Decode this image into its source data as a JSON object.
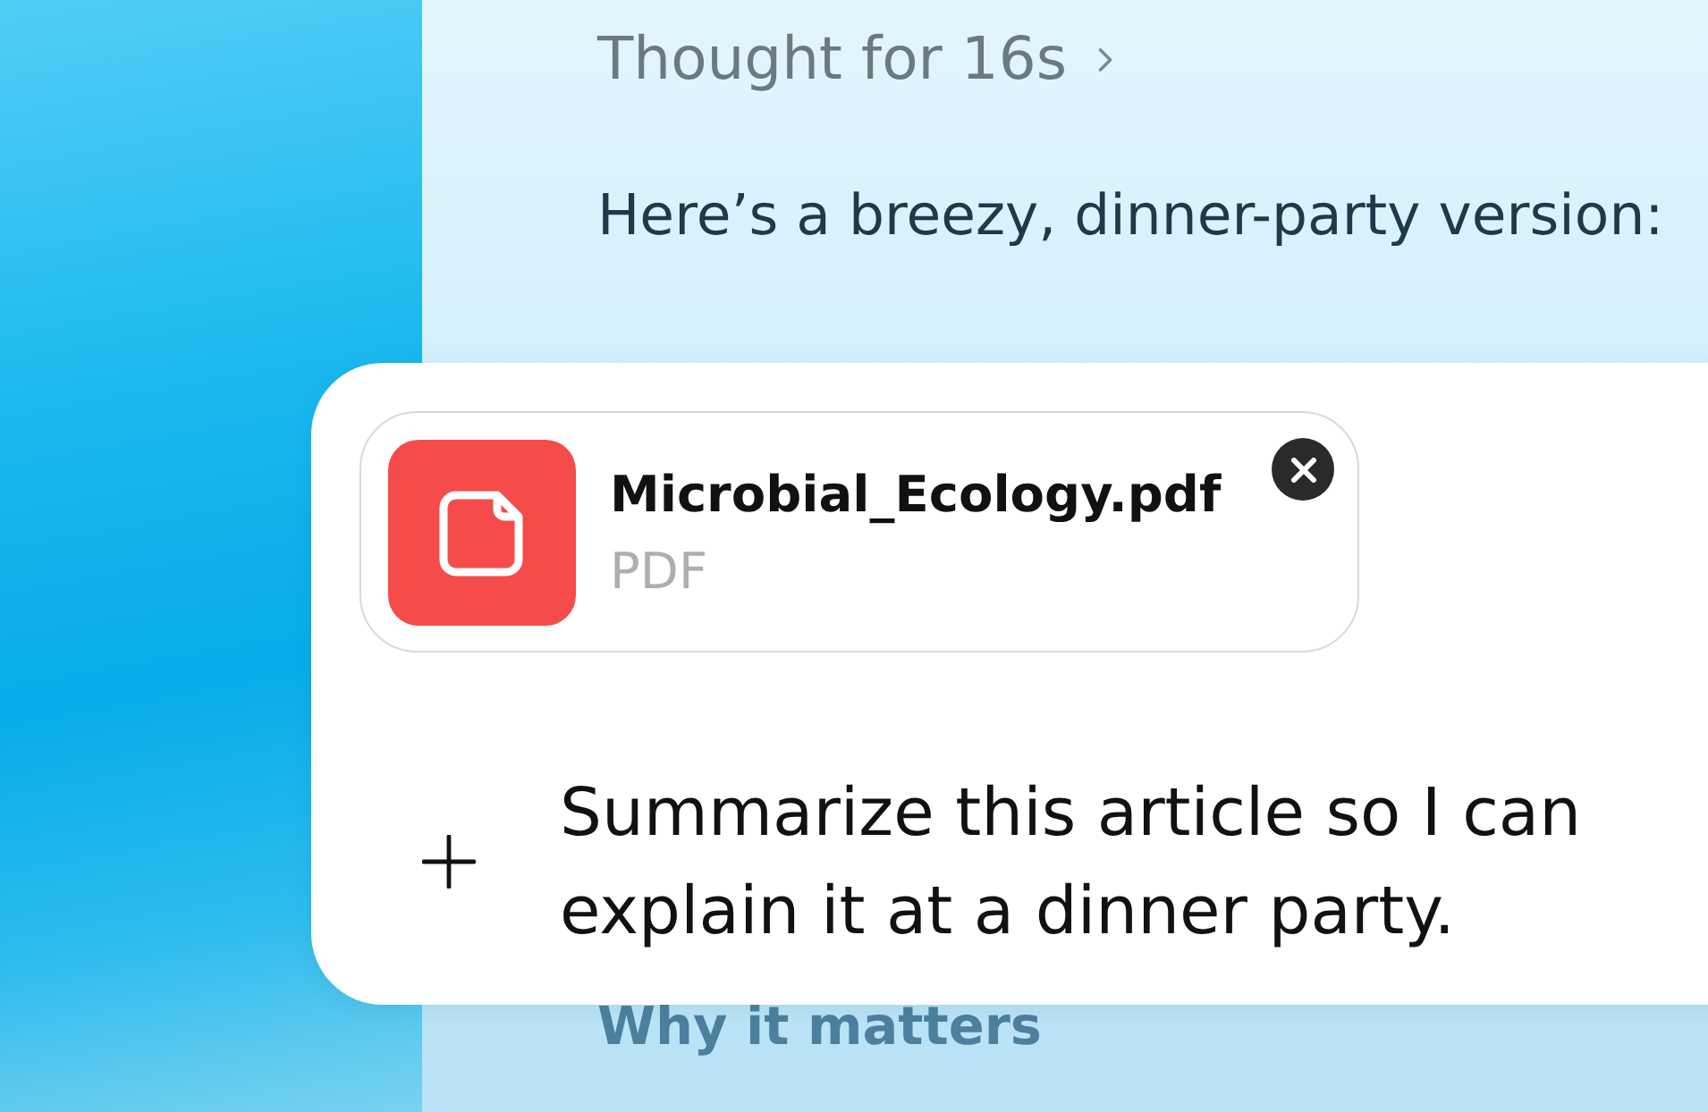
{
  "thought": {
    "label": "Thought for 16s"
  },
  "message": {
    "text": "Here’s a breezy, dinner-party version:",
    "section_heading": "Why it matters"
  },
  "composer": {
    "attachments": [
      {
        "name": "Microbial_Ecology.pdf",
        "type": "PDF"
      }
    ],
    "input": {
      "value": "Summarize this article so I can explain it at a dinner party."
    }
  }
}
